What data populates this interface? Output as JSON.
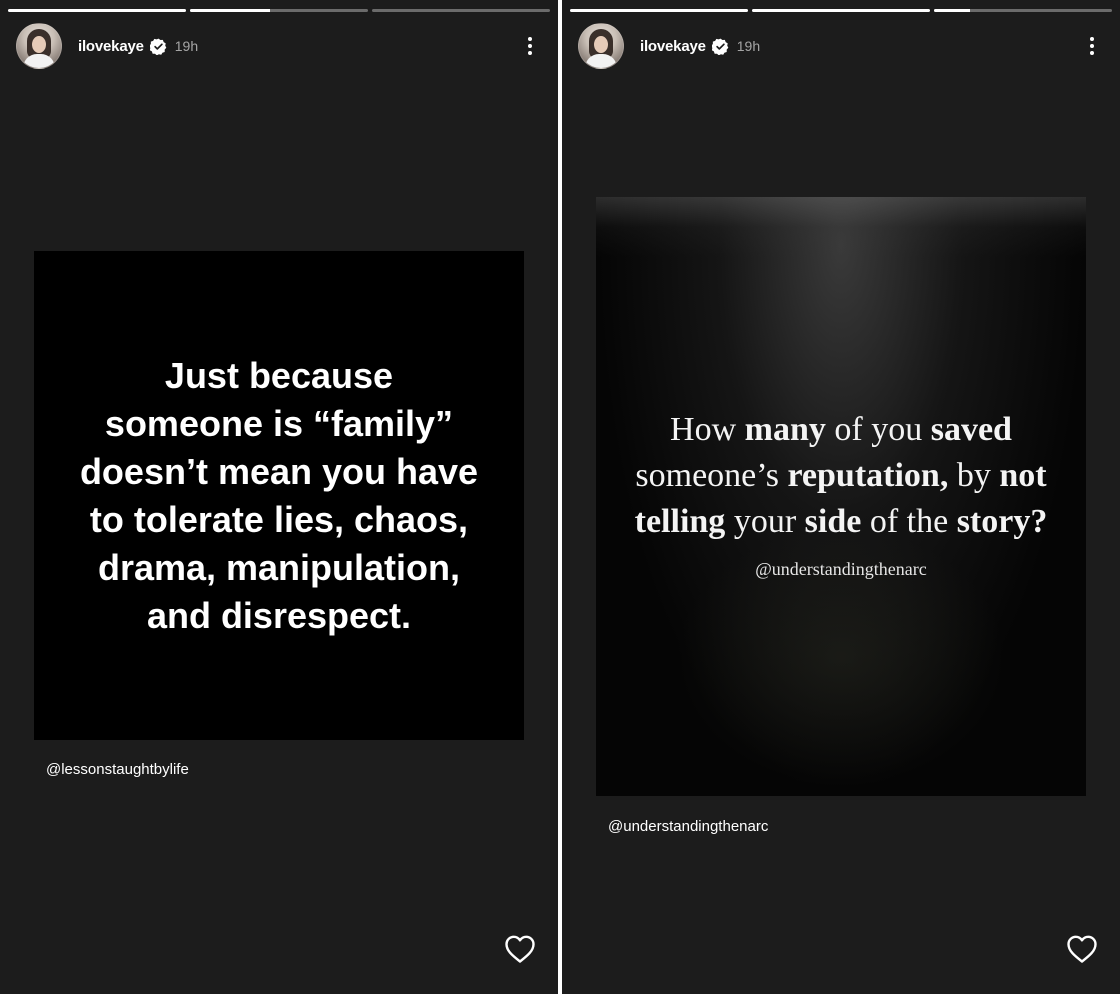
{
  "stories": [
    {
      "progress": [
        1,
        0.45,
        0
      ],
      "user": {
        "username": "ilovekaye",
        "time": "19h",
        "verified": true
      },
      "post": {
        "lines": [
          "Just because",
          "someone is “family”",
          "doesn’t mean you have",
          "to tolerate lies, chaos,",
          "drama, manipulation,",
          "and disrespect."
        ]
      },
      "mention": "@lessonstaughtbylife",
      "icons": {
        "menu": "more-vertical-icon",
        "like": "heart-icon",
        "badge": "verified-badge-icon"
      }
    },
    {
      "progress": [
        1,
        1,
        0.2
      ],
      "user": {
        "username": "ilovekaye",
        "time": "19h",
        "verified": true
      },
      "post": {
        "line1_a": "How ",
        "line1_b": "many",
        "line1_c": " of you ",
        "line1_d": "saved",
        "line2_a": "someone’s ",
        "line2_b": "reputation,",
        "line2_c": " by ",
        "line2_d": "not",
        "line3_a": "telling",
        "line3_b": " your ",
        "line3_c": "side",
        "line3_d": " of the ",
        "line3_e": "story?",
        "handle": "@understandingthenarc"
      },
      "mention": "@understandingthenarc",
      "icons": {
        "menu": "more-vertical-icon",
        "like": "heart-icon",
        "badge": "verified-badge-icon"
      }
    }
  ],
  "colors": {
    "panel_bg": "#1c1c1c",
    "text": "#ffffff",
    "divider": "#ffffff"
  }
}
